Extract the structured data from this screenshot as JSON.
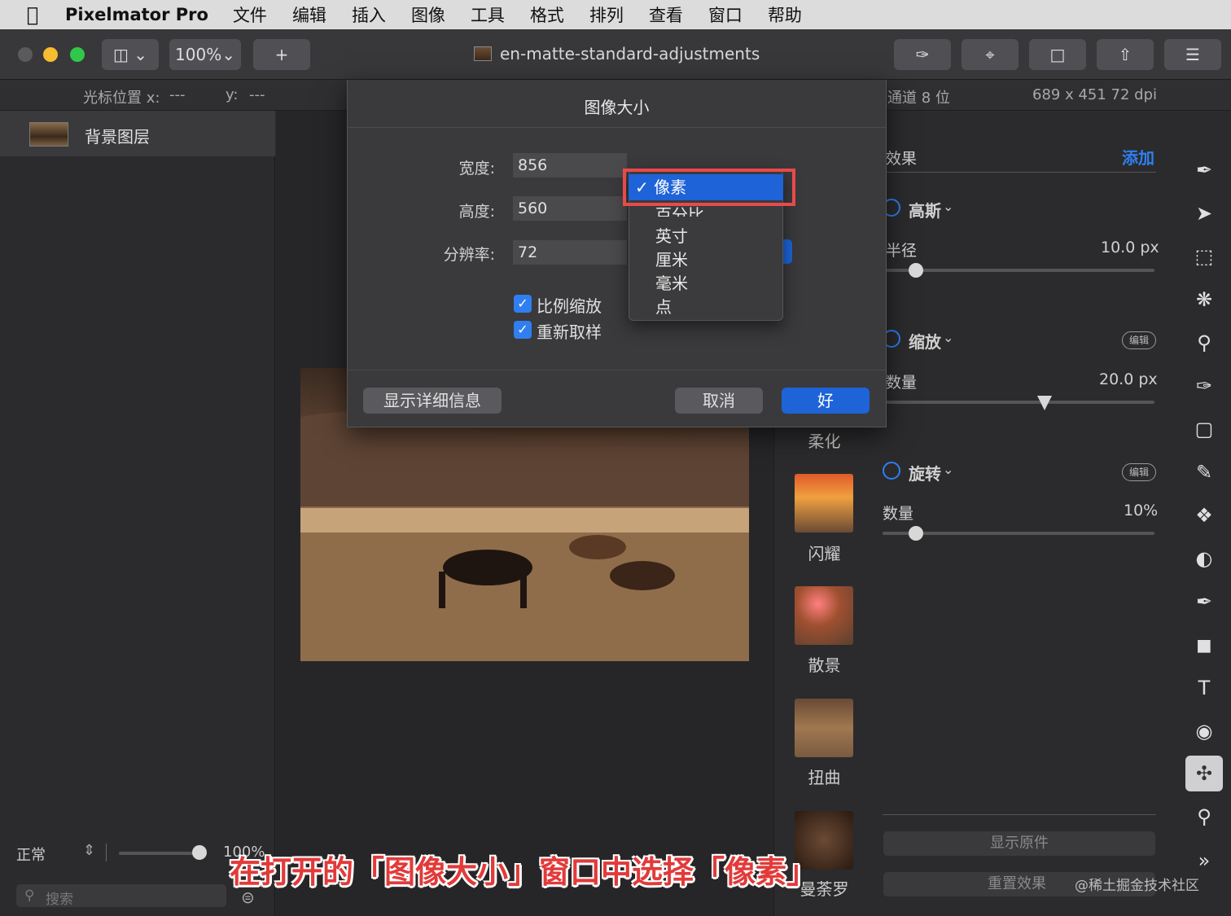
{
  "menubar": {
    "apple": "",
    "app": "Pixelmator Pro",
    "items": [
      "文件",
      "编辑",
      "插入",
      "图像",
      "工具",
      "格式",
      "排列",
      "查看",
      "窗口",
      "帮助"
    ]
  },
  "toolbar": {
    "zoom": "100%",
    "add": "+",
    "title": "en-matte-standard-adjustments"
  },
  "infobar": {
    "cursor_label": "光标位置 x:",
    "x_val": "---",
    "y_label": "y:",
    "y_val": "---",
    "channels": "通道 8 位",
    "dims": "689 x 451 72 dpi"
  },
  "layers": {
    "name": "背景图层"
  },
  "bottom_left": {
    "blend": "正常",
    "opacity": "100%",
    "search_placeholder": "搜索"
  },
  "dialog": {
    "title": "图像大小",
    "width_label": "宽度:",
    "width_value": "856",
    "height_label": "高度:",
    "height_value": "560",
    "res_label": "分辨率:",
    "res_value": "72",
    "constrain": "比例缩放",
    "resample": "重新取样",
    "details_btn": "显示详细信息",
    "cancel_btn": "取消",
    "ok_btn": "好"
  },
  "dropdown": {
    "selected": "像素",
    "items": [
      "百分比",
      "英寸",
      "厘米",
      "毫米",
      "点"
    ]
  },
  "effects_col": {
    "labels": [
      "柔化",
      "闪耀",
      "散景",
      "扭曲",
      "曼荼罗"
    ]
  },
  "right": {
    "effects_title": "效果",
    "add": "添加",
    "gauss": "高斯",
    "radius_label": "半径",
    "radius_val": "10.0 px",
    "radius_level": 0.12,
    "zoom": "缩放",
    "edit": "编辑",
    "amount_label": "数量",
    "amount_val": "20.0 px",
    "amount_level": 0.59,
    "rotate": "旋转",
    "amount2_label": "数量",
    "amount2_val": "10%",
    "amount2_level": 0.12,
    "show_original": "显示原件",
    "reset": "重置效果"
  },
  "caption": "在打开的「图像大小」窗口中选择「像素」",
  "watermark": "@稀土掘金技术社区",
  "colors": {
    "accent": "#2f7ff0",
    "highlight": "#e84a4a",
    "menubar": "#dcdcdc"
  }
}
